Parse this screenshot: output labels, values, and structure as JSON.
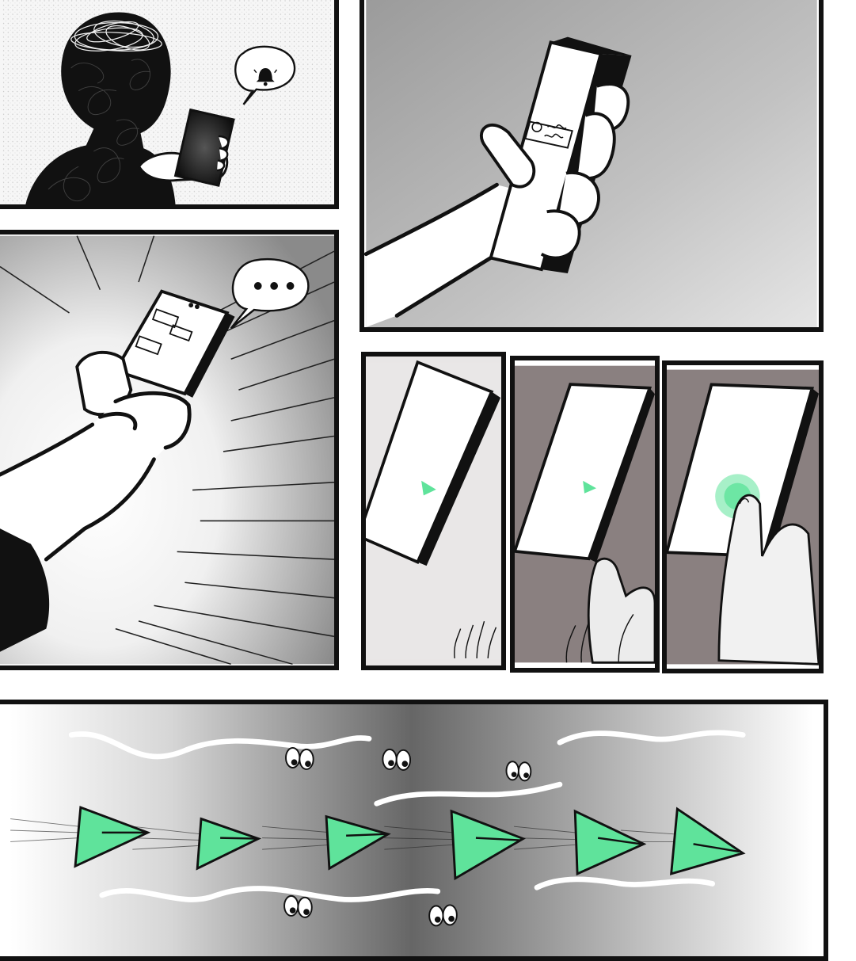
{
  "comic": {
    "panel_count": 7,
    "accent_green": "#5fe39b",
    "notification_icon": "bell-icon",
    "speech_icon": "ellipsis-icon",
    "send_icon": "paper-plane-icon",
    "eye_icon": "googly-eyes-icon"
  }
}
